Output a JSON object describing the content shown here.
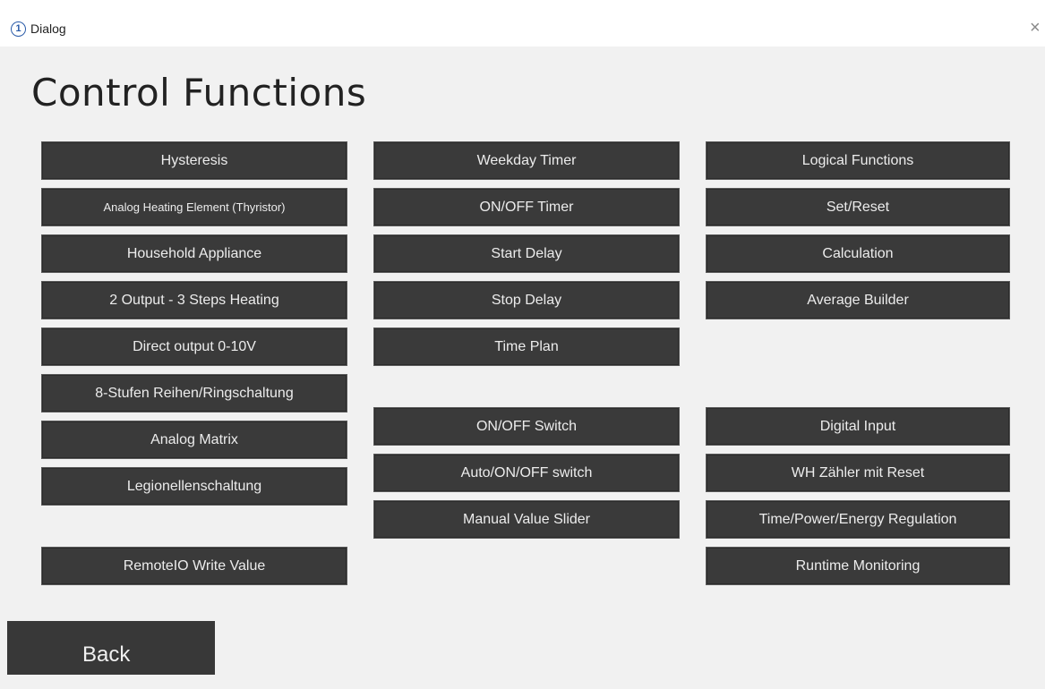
{
  "window": {
    "title": "Dialog",
    "app_icon_glyph": "1",
    "close_glyph": "×"
  },
  "page": {
    "title": "Control Functions"
  },
  "columns": {
    "left": [
      "Hysteresis",
      "Analog Heating Element (Thyristor)",
      "Household Appliance",
      "2 Output - 3 Steps Heating",
      "Direct output 0-10V",
      "8-Stufen Reihen/Ringschaltung",
      "Analog Matrix",
      "Legionellenschaltung",
      "RemoteIO Write Value"
    ],
    "middle": [
      "Weekday Timer",
      "ON/OFF Timer",
      "Start Delay",
      "Stop Delay",
      "Time Plan",
      "ON/OFF Switch",
      "Auto/ON/OFF switch",
      "Manual Value Slider"
    ],
    "right": [
      "Logical Functions",
      "Set/Reset",
      "Calculation",
      "Average Builder",
      "Digital Input",
      "WH Zähler mit Reset",
      "Time/Power/Energy Regulation",
      "Runtime Monitoring"
    ]
  },
  "back_label": "Back",
  "colors": {
    "background": "#f1f1f1",
    "button_bg": "#3a3a3a",
    "button_text": "#ececec",
    "accent": "#2a5ba8"
  }
}
